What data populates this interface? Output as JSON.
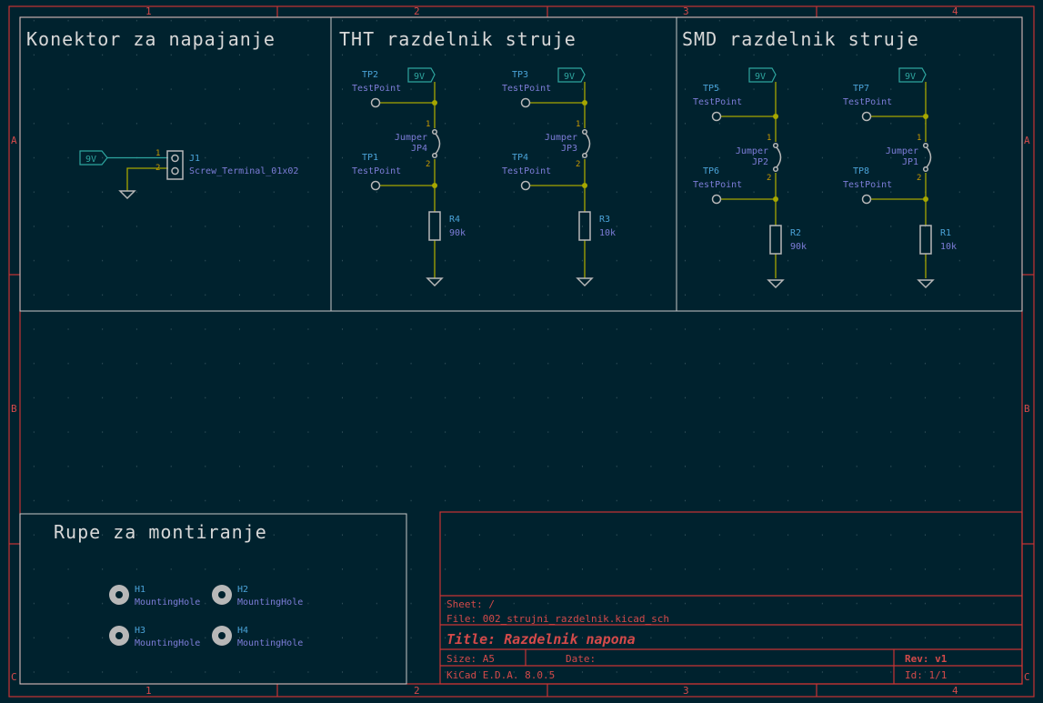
{
  "frame": {
    "columns": [
      "1",
      "2",
      "3",
      "4"
    ],
    "rows": [
      "A",
      "B",
      "C"
    ]
  },
  "sheets": {
    "connector": {
      "title": "Konektor za napajanje",
      "net": "9V",
      "ref": "J1",
      "value": "Screw_Terminal_01x02",
      "pins": [
        "1",
        "2"
      ]
    },
    "tht": {
      "title": "THT razdelnik struje"
    },
    "smd": {
      "title": "SMD razdelnik struje"
    },
    "holes": {
      "title": "Rupe za montiranje",
      "items": [
        {
          "ref": "H1",
          "value": "MountingHole"
        },
        {
          "ref": "H2",
          "value": "MountingHole"
        },
        {
          "ref": "H3",
          "value": "MountingHole"
        },
        {
          "ref": "H4",
          "value": "MountingHole"
        }
      ]
    }
  },
  "circuits": [
    {
      "net": "9V",
      "tp_top": "TP2",
      "tp_bot": "TP1",
      "tp_value": "TestPoint",
      "jumper_value": "Jumper",
      "jumper_ref": "JP4",
      "pin1": "1",
      "pin2": "2",
      "r_ref": "R4",
      "r_value": "90k"
    },
    {
      "net": "9V",
      "tp_top": "TP3",
      "tp_bot": "TP4",
      "tp_value": "TestPoint",
      "jumper_value": "Jumper",
      "jumper_ref": "JP3",
      "pin1": "1",
      "pin2": "2",
      "r_ref": "R3",
      "r_value": "10k"
    },
    {
      "net": "9V",
      "tp_top": "TP5",
      "tp_bot": "TP6",
      "tp_value": "TestPoint",
      "jumper_value": "Jumper",
      "jumper_ref": "JP2",
      "pin1": "1",
      "pin2": "2",
      "r_ref": "R2",
      "r_value": "90k"
    },
    {
      "net": "9V",
      "tp_top": "TP7",
      "tp_bot": "TP8",
      "tp_value": "TestPoint",
      "jumper_value": "Jumper",
      "jumper_ref": "JP1",
      "pin1": "1",
      "pin2": "2",
      "r_ref": "R1",
      "r_value": "10k"
    }
  ],
  "title_block": {
    "sheet": "Sheet: /",
    "file": "File: 002_strujni_razdelnik.kicad_sch",
    "title": "Title: Razdelnik napona",
    "size": "Size: A5",
    "date": "Date:",
    "rev": "Rev: v1",
    "tool": "KiCad E.D.A. 8.0.5",
    "id": "Id: 1/1"
  },
  "colors": {
    "background": "#00222e",
    "frame": "#c83434",
    "wire": "#a6a600",
    "net_label": "#2ea59f"
  }
}
